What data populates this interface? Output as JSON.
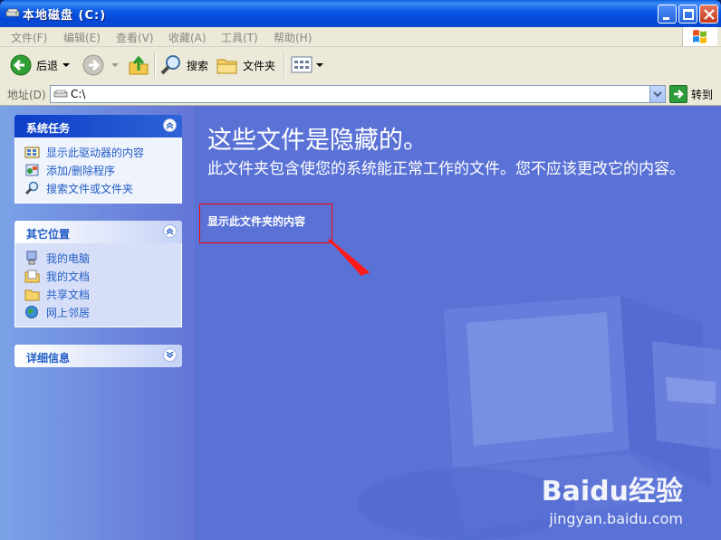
{
  "window": {
    "title": "本地磁盘 (C:)"
  },
  "menu": [
    "文件(F)",
    "编辑(E)",
    "查看(V)",
    "收藏(A)",
    "工具(T)",
    "帮助(H)"
  ],
  "toolbar": {
    "back": "后退",
    "search": "搜索",
    "folders": "文件夹"
  },
  "address": {
    "label": "地址(D)",
    "value": "C:\\",
    "go": "转到"
  },
  "system_tasks": {
    "title": "系统任务",
    "items": [
      "显示此驱动器的内容",
      "添加/删除程序",
      "搜索文件或文件夹"
    ]
  },
  "other_places": {
    "title": "其它位置",
    "items": [
      "我的电脑",
      "我的文档",
      "共享文档",
      "网上邻居"
    ]
  },
  "details": {
    "title": "详细信息"
  },
  "content": {
    "title": "这些文件是隐藏的。",
    "description": "此文件夹包含使您的系统能正常工作的文件。您不应该更改它的内容。",
    "show_link": "显示此文件夹的内容"
  },
  "watermark": {
    "logo": "Baidu经验",
    "url": "jingyan.baidu.com"
  },
  "colors": {
    "highlight": "#ff0000",
    "link": "#215dc6",
    "pane_bg": "#5a72d6"
  }
}
